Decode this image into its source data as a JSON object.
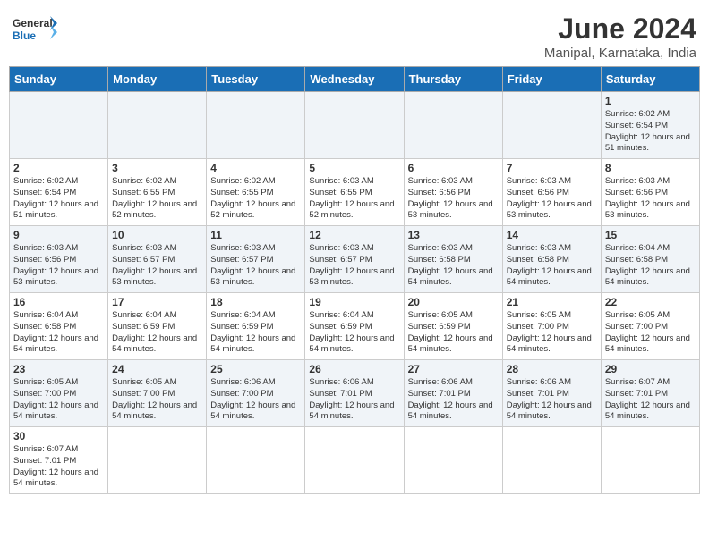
{
  "header": {
    "logo_general": "General",
    "logo_blue": "Blue",
    "title": "June 2024",
    "subtitle": "Manipal, Karnataka, India"
  },
  "days_of_week": [
    "Sunday",
    "Monday",
    "Tuesday",
    "Wednesday",
    "Thursday",
    "Friday",
    "Saturday"
  ],
  "weeks": [
    [
      {
        "day": "",
        "sunrise": "",
        "sunset": "",
        "daylight": ""
      },
      {
        "day": "",
        "sunrise": "",
        "sunset": "",
        "daylight": ""
      },
      {
        "day": "",
        "sunrise": "",
        "sunset": "",
        "daylight": ""
      },
      {
        "day": "",
        "sunrise": "",
        "sunset": "",
        "daylight": ""
      },
      {
        "day": "",
        "sunrise": "",
        "sunset": "",
        "daylight": ""
      },
      {
        "day": "",
        "sunrise": "",
        "sunset": "",
        "daylight": ""
      },
      {
        "day": "1",
        "sunrise": "Sunrise: 6:02 AM",
        "sunset": "Sunset: 6:54 PM",
        "daylight": "Daylight: 12 hours and 51 minutes."
      }
    ],
    [
      {
        "day": "2",
        "sunrise": "Sunrise: 6:02 AM",
        "sunset": "Sunset: 6:54 PM",
        "daylight": "Daylight: 12 hours and 51 minutes."
      },
      {
        "day": "3",
        "sunrise": "Sunrise: 6:02 AM",
        "sunset": "Sunset: 6:55 PM",
        "daylight": "Daylight: 12 hours and 52 minutes."
      },
      {
        "day": "4",
        "sunrise": "Sunrise: 6:02 AM",
        "sunset": "Sunset: 6:55 PM",
        "daylight": "Daylight: 12 hours and 52 minutes."
      },
      {
        "day": "5",
        "sunrise": "Sunrise: 6:03 AM",
        "sunset": "Sunset: 6:55 PM",
        "daylight": "Daylight: 12 hours and 52 minutes."
      },
      {
        "day": "6",
        "sunrise": "Sunrise: 6:03 AM",
        "sunset": "Sunset: 6:56 PM",
        "daylight": "Daylight: 12 hours and 53 minutes."
      },
      {
        "day": "7",
        "sunrise": "Sunrise: 6:03 AM",
        "sunset": "Sunset: 6:56 PM",
        "daylight": "Daylight: 12 hours and 53 minutes."
      },
      {
        "day": "8",
        "sunrise": "Sunrise: 6:03 AM",
        "sunset": "Sunset: 6:56 PM",
        "daylight": "Daylight: 12 hours and 53 minutes."
      }
    ],
    [
      {
        "day": "9",
        "sunrise": "Sunrise: 6:03 AM",
        "sunset": "Sunset: 6:56 PM",
        "daylight": "Daylight: 12 hours and 53 minutes."
      },
      {
        "day": "10",
        "sunrise": "Sunrise: 6:03 AM",
        "sunset": "Sunset: 6:57 PM",
        "daylight": "Daylight: 12 hours and 53 minutes."
      },
      {
        "day": "11",
        "sunrise": "Sunrise: 6:03 AM",
        "sunset": "Sunset: 6:57 PM",
        "daylight": "Daylight: 12 hours and 53 minutes."
      },
      {
        "day": "12",
        "sunrise": "Sunrise: 6:03 AM",
        "sunset": "Sunset: 6:57 PM",
        "daylight": "Daylight: 12 hours and 53 minutes."
      },
      {
        "day": "13",
        "sunrise": "Sunrise: 6:03 AM",
        "sunset": "Sunset: 6:58 PM",
        "daylight": "Daylight: 12 hours and 54 minutes."
      },
      {
        "day": "14",
        "sunrise": "Sunrise: 6:03 AM",
        "sunset": "Sunset: 6:58 PM",
        "daylight": "Daylight: 12 hours and 54 minutes."
      },
      {
        "day": "15",
        "sunrise": "Sunrise: 6:04 AM",
        "sunset": "Sunset: 6:58 PM",
        "daylight": "Daylight: 12 hours and 54 minutes."
      }
    ],
    [
      {
        "day": "16",
        "sunrise": "Sunrise: 6:04 AM",
        "sunset": "Sunset: 6:58 PM",
        "daylight": "Daylight: 12 hours and 54 minutes."
      },
      {
        "day": "17",
        "sunrise": "Sunrise: 6:04 AM",
        "sunset": "Sunset: 6:59 PM",
        "daylight": "Daylight: 12 hours and 54 minutes."
      },
      {
        "day": "18",
        "sunrise": "Sunrise: 6:04 AM",
        "sunset": "Sunset: 6:59 PM",
        "daylight": "Daylight: 12 hours and 54 minutes."
      },
      {
        "day": "19",
        "sunrise": "Sunrise: 6:04 AM",
        "sunset": "Sunset: 6:59 PM",
        "daylight": "Daylight: 12 hours and 54 minutes."
      },
      {
        "day": "20",
        "sunrise": "Sunrise: 6:05 AM",
        "sunset": "Sunset: 6:59 PM",
        "daylight": "Daylight: 12 hours and 54 minutes."
      },
      {
        "day": "21",
        "sunrise": "Sunrise: 6:05 AM",
        "sunset": "Sunset: 7:00 PM",
        "daylight": "Daylight: 12 hours and 54 minutes."
      },
      {
        "day": "22",
        "sunrise": "Sunrise: 6:05 AM",
        "sunset": "Sunset: 7:00 PM",
        "daylight": "Daylight: 12 hours and 54 minutes."
      }
    ],
    [
      {
        "day": "23",
        "sunrise": "Sunrise: 6:05 AM",
        "sunset": "Sunset: 7:00 PM",
        "daylight": "Daylight: 12 hours and 54 minutes."
      },
      {
        "day": "24",
        "sunrise": "Sunrise: 6:05 AM",
        "sunset": "Sunset: 7:00 PM",
        "daylight": "Daylight: 12 hours and 54 minutes."
      },
      {
        "day": "25",
        "sunrise": "Sunrise: 6:06 AM",
        "sunset": "Sunset: 7:00 PM",
        "daylight": "Daylight: 12 hours and 54 minutes."
      },
      {
        "day": "26",
        "sunrise": "Sunrise: 6:06 AM",
        "sunset": "Sunset: 7:01 PM",
        "daylight": "Daylight: 12 hours and 54 minutes."
      },
      {
        "day": "27",
        "sunrise": "Sunrise: 6:06 AM",
        "sunset": "Sunset: 7:01 PM",
        "daylight": "Daylight: 12 hours and 54 minutes."
      },
      {
        "day": "28",
        "sunrise": "Sunrise: 6:06 AM",
        "sunset": "Sunset: 7:01 PM",
        "daylight": "Daylight: 12 hours and 54 minutes."
      },
      {
        "day": "29",
        "sunrise": "Sunrise: 6:07 AM",
        "sunset": "Sunset: 7:01 PM",
        "daylight": "Daylight: 12 hours and 54 minutes."
      }
    ],
    [
      {
        "day": "30",
        "sunrise": "Sunrise: 6:07 AM",
        "sunset": "Sunset: 7:01 PM",
        "daylight": "Daylight: 12 hours and 54 minutes."
      },
      {
        "day": "",
        "sunrise": "",
        "sunset": "",
        "daylight": ""
      },
      {
        "day": "",
        "sunrise": "",
        "sunset": "",
        "daylight": ""
      },
      {
        "day": "",
        "sunrise": "",
        "sunset": "",
        "daylight": ""
      },
      {
        "day": "",
        "sunrise": "",
        "sunset": "",
        "daylight": ""
      },
      {
        "day": "",
        "sunrise": "",
        "sunset": "",
        "daylight": ""
      },
      {
        "day": "",
        "sunrise": "",
        "sunset": "",
        "daylight": ""
      }
    ]
  ]
}
